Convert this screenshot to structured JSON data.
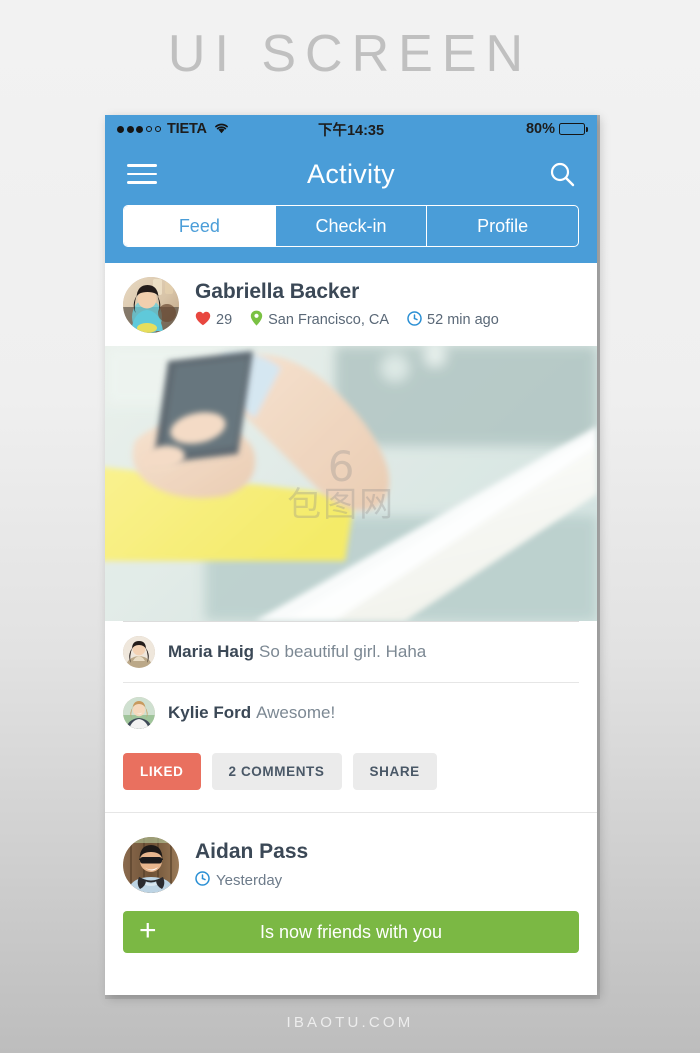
{
  "poster": {
    "title": "UI SCREEN",
    "footer": "IBAOTU.COM"
  },
  "colors": {
    "brand_blue": "#4a9dd8",
    "liked_coral": "#e9705f",
    "friend_green": "#7bb844",
    "heart_red": "#e8473f",
    "pin_green": "#7ac143",
    "clock_blue": "#2a8fd4",
    "text_dark": "#3b4856",
    "text_muted": "#7c8893",
    "chip_grey": "#ebebeb"
  },
  "status_bar": {
    "carrier": "TIETA",
    "signal_dots_filled": 3,
    "signal_dots_empty": 2,
    "wifi_icon": "wifi-icon",
    "time": "下午14:35",
    "battery_percent": "80%",
    "battery_level": 80
  },
  "navbar": {
    "menu_icon": "hamburger-menu-icon",
    "title": "Activity",
    "search_icon": "search-icon"
  },
  "tabs": [
    {
      "label": "Feed",
      "active": true
    },
    {
      "label": "Check-in",
      "active": false
    },
    {
      "label": "Profile",
      "active": false
    }
  ],
  "post": {
    "author": "Gabriella Backer",
    "avatar_name": "avatar-gabriella-backer",
    "likes_icon": "heart-icon",
    "likes": "29",
    "location_icon": "map-pin-icon",
    "location": "San Francisco, CA",
    "time_icon": "clock-icon",
    "time": "52 min ago",
    "photo_name": "post-photo-hand-holding-phone",
    "watermark": {
      "mark": "6",
      "text": "包图网"
    },
    "comments": [
      {
        "name": "Maria Haig",
        "text": "So beautiful girl. Haha",
        "avatar_name": "avatar-maria-haig"
      },
      {
        "name": "Kylie Ford",
        "text": "Awesome!",
        "avatar_name": "avatar-kylie-ford"
      }
    ],
    "actions": [
      {
        "label": "LIKED",
        "style": "liked"
      },
      {
        "label": "2 COMMENTS",
        "style": "plain"
      },
      {
        "label": "SHARE",
        "style": "plain"
      }
    ]
  },
  "post2": {
    "author": "Aidan Pass",
    "avatar_name": "avatar-aidan-pass",
    "time_icon": "clock-icon",
    "time": "Yesterday",
    "friend_plus_icon": "plus-icon",
    "friend_label": "Is now friends with you"
  }
}
